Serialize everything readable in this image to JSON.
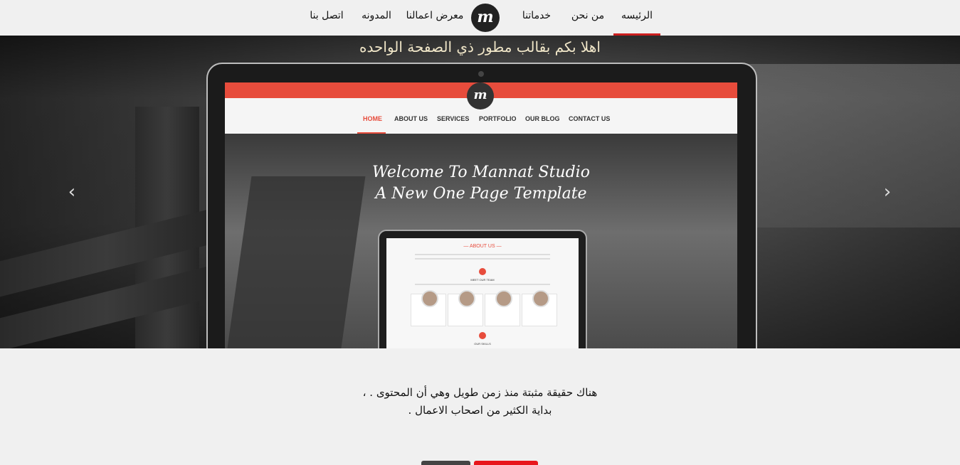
{
  "nav": {
    "items": [
      {
        "label": "الرئيسه",
        "active": true
      },
      {
        "label": "من نحن",
        "active": false
      },
      {
        "label": "خدماتنا",
        "active": false
      },
      {
        "label": "معرض اعمالنا",
        "active": false
      },
      {
        "label": "المدونه",
        "active": false
      },
      {
        "label": "اتصل بنا",
        "active": false
      }
    ],
    "logo": "m",
    "active_color": "#cc1f1f"
  },
  "hero": {
    "title": "اهلا بكم بقالب مطور ذي الصفحة الواحده",
    "prev_icon": "chevron-left-icon",
    "next_icon": "chevron-right-icon",
    "screen": {
      "logo": "m",
      "menu": [
        "HOME",
        "ABOUT US",
        "SERVICES",
        "PORTFOLIO",
        "OUR BLOG",
        "CONTACT US"
      ],
      "title_line1": "Welcome To Mannat Studio",
      "title_line2": "A New One Page Template",
      "section_heading": "— ABOUT US —",
      "meet_team": "MEET OUR TEAM",
      "skills": "OUR SKILLS"
    }
  },
  "intro": {
    "line1": "هناك حقيقة مثبتة منذ زمن طويل وهي أن المحتوى . ،",
    "line2": "بداية الكثير من اصحاب الاعمال ."
  },
  "colors": {
    "accent": "#e8161c",
    "dark_button": "#444444"
  }
}
